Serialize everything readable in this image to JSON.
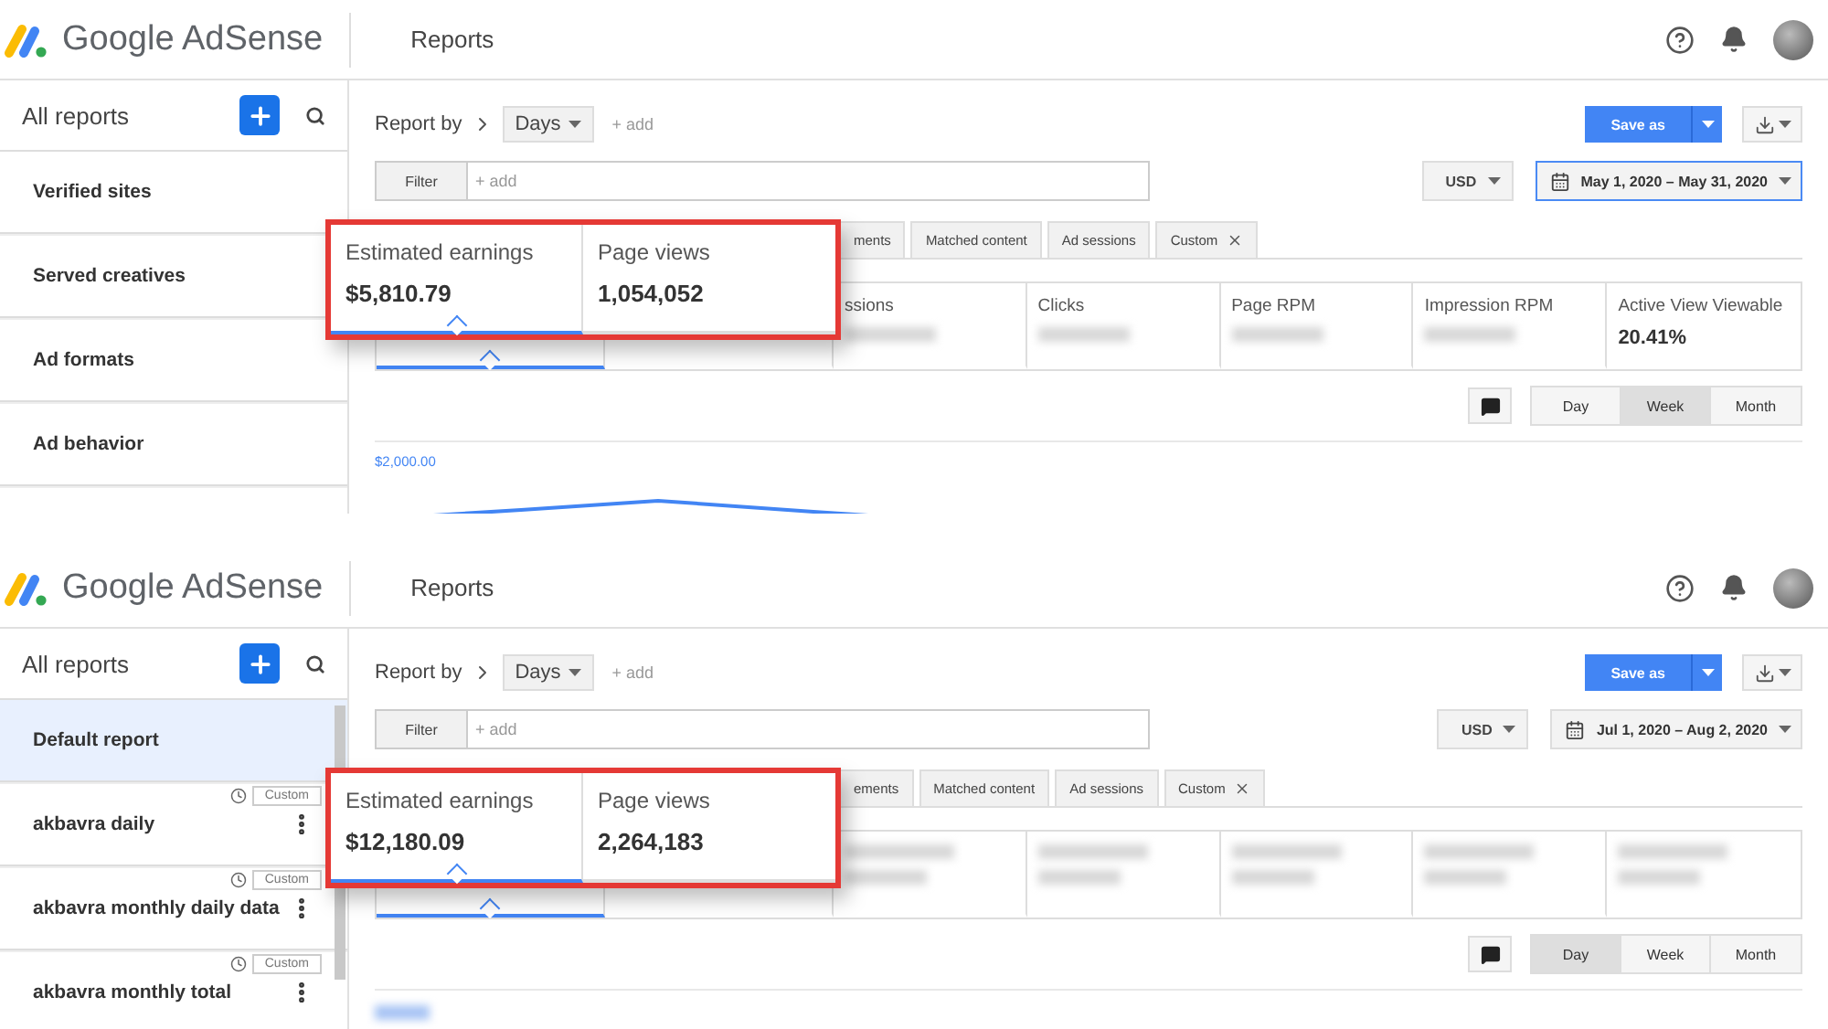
{
  "panels": [
    {
      "header": {
        "brand": "Google AdSense",
        "section": "Reports"
      },
      "sidebar": {
        "title": "All reports",
        "items": [
          {
            "label": "Verified sites",
            "selected": false
          },
          {
            "label": "Served creatives",
            "selected": false
          },
          {
            "label": "Ad formats",
            "selected": false
          },
          {
            "label": "Ad behavior",
            "selected": false
          }
        ]
      },
      "report_by": {
        "label": "Report by",
        "dimension": "Days",
        "add": "+ add"
      },
      "save_button": "Save as",
      "filter": {
        "label": "Filter",
        "placeholder": "+ add"
      },
      "currency": "USD",
      "date_range": {
        "value": "May 1, 2020 – May 31, 2020",
        "focused": true
      },
      "tabs": [
        {
          "label": "ments",
          "closable": false
        },
        {
          "label": "Matched content",
          "closable": false
        },
        {
          "label": "Ad sessions",
          "closable": false
        },
        {
          "label": "Custom",
          "closable": true
        }
      ],
      "metrics": [
        {
          "kind": "covered",
          "selected": true
        },
        {
          "kind": "covered",
          "selected": false
        },
        {
          "kind": "text",
          "label": "ssions",
          "selected": false
        },
        {
          "kind": "text",
          "label": "Clicks",
          "selected": false
        },
        {
          "kind": "text",
          "label": "Page RPM",
          "selected": false
        },
        {
          "kind": "text",
          "label": "Impression RPM",
          "selected": false
        },
        {
          "kind": "text",
          "label": "Active View Viewable",
          "value": "20.41%",
          "selected": false
        }
      ],
      "periods": [
        {
          "label": "Day",
          "selected": false
        },
        {
          "label": "Week",
          "selected": true
        },
        {
          "label": "Month",
          "selected": false
        }
      ],
      "chart": {
        "kind": "line",
        "axis_label": "$2,000.00"
      },
      "highlight": [
        {
          "label": "Estimated earnings",
          "value": "$5,810.79",
          "selected": true
        },
        {
          "label": "Page views",
          "value": "1,054,052",
          "selected": false
        }
      ]
    },
    {
      "header": {
        "brand": "Google AdSense",
        "section": "Reports"
      },
      "sidebar": {
        "title": "All reports",
        "items": [
          {
            "label": "Default report",
            "selected": true
          },
          {
            "label": "akbavra daily",
            "badge": "Custom",
            "selected": false
          },
          {
            "label": "akbavra monthly daily data",
            "badge": "Custom",
            "selected": false
          },
          {
            "label": "akbavra monthly total",
            "badge": "Custom",
            "selected": false
          }
        ]
      },
      "report_by": {
        "label": "Report by",
        "dimension": "Days",
        "add": "+ add"
      },
      "save_button": "Save as",
      "filter": {
        "label": "Filter",
        "placeholder": "+ add"
      },
      "currency": "USD",
      "date_range": {
        "value": "Jul 1, 2020 – Aug 2, 2020",
        "focused": false
      },
      "tabs": [
        {
          "label": "ements",
          "closable": false
        },
        {
          "label": "Matched content",
          "closable": false
        },
        {
          "label": "Ad sessions",
          "closable": false
        },
        {
          "label": "Custom",
          "closable": true
        }
      ],
      "metrics": [
        {
          "kind": "covered",
          "selected": true
        },
        {
          "kind": "covered",
          "selected": false
        },
        {
          "kind": "blurred",
          "selected": false
        },
        {
          "kind": "blurred",
          "selected": false
        },
        {
          "kind": "blurred",
          "selected": false
        },
        {
          "kind": "blurred",
          "selected": false
        },
        {
          "kind": "blurred",
          "selected": false
        }
      ],
      "periods": [
        {
          "label": "Day",
          "selected": true
        },
        {
          "label": "Week",
          "selected": false
        },
        {
          "label": "Month",
          "selected": false
        }
      ],
      "chart": {
        "kind": "blurred"
      },
      "highlight": [
        {
          "label": "Estimated earnings",
          "value": "$12,180.09",
          "selected": true
        },
        {
          "label": "Page views",
          "value": "2,264,183",
          "selected": false
        }
      ]
    }
  ]
}
